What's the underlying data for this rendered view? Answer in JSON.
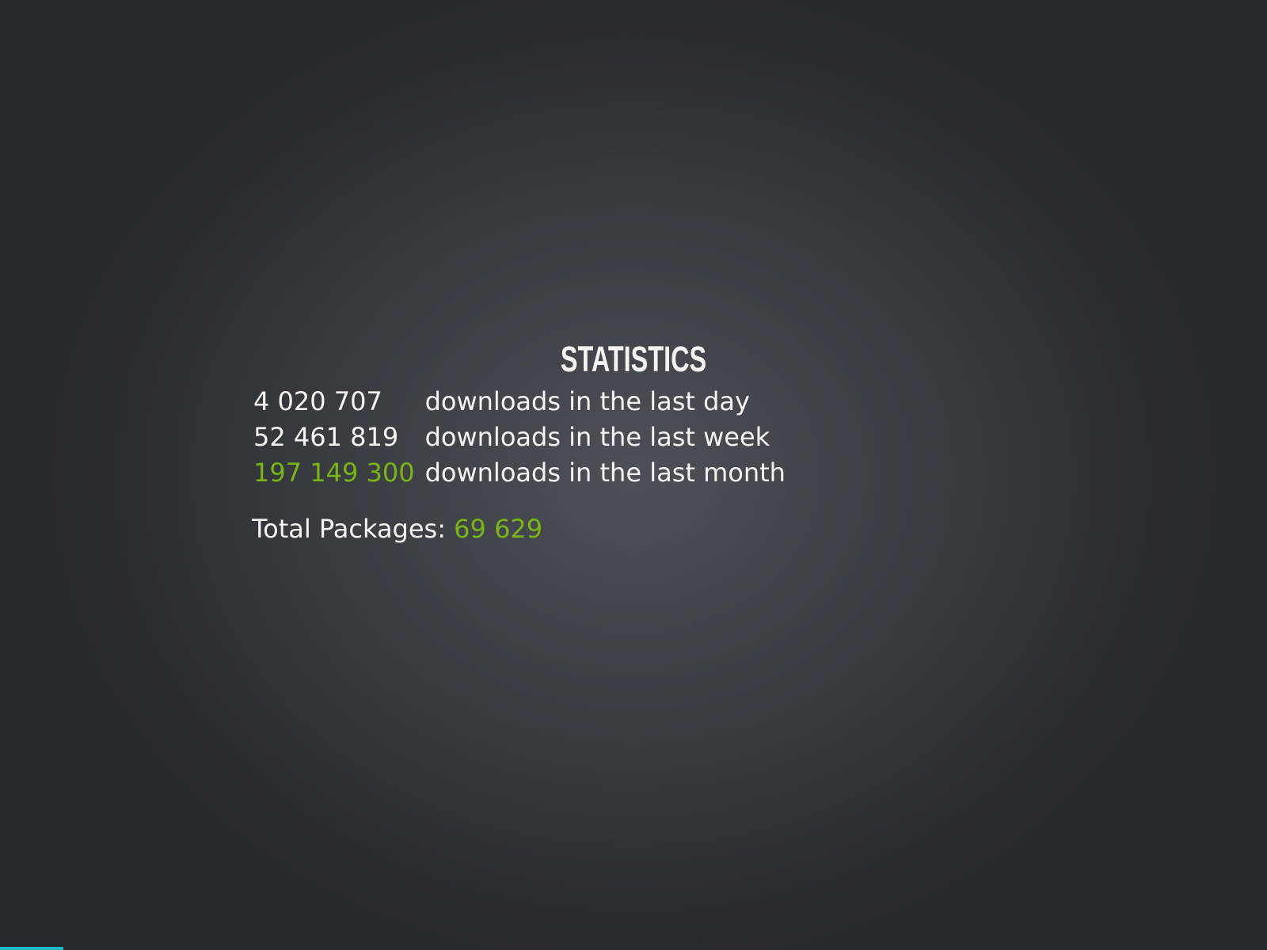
{
  "stats": {
    "title": "STATISTICS",
    "rows": [
      {
        "count": "4 020 707",
        "description": "downloads in the last day",
        "highlight": false
      },
      {
        "count": "52 461 819",
        "description": "downloads in the last week",
        "highlight": false
      },
      {
        "count": "197 149 300",
        "description": "downloads in the last month",
        "highlight": true
      }
    ],
    "total_label": "Total Packages:",
    "total_value": "69 629"
  },
  "colors": {
    "highlight": "#7ab416",
    "text": "#f4f4f4",
    "progress": "#21b8cc"
  },
  "progress": {
    "fraction": 0.05
  }
}
